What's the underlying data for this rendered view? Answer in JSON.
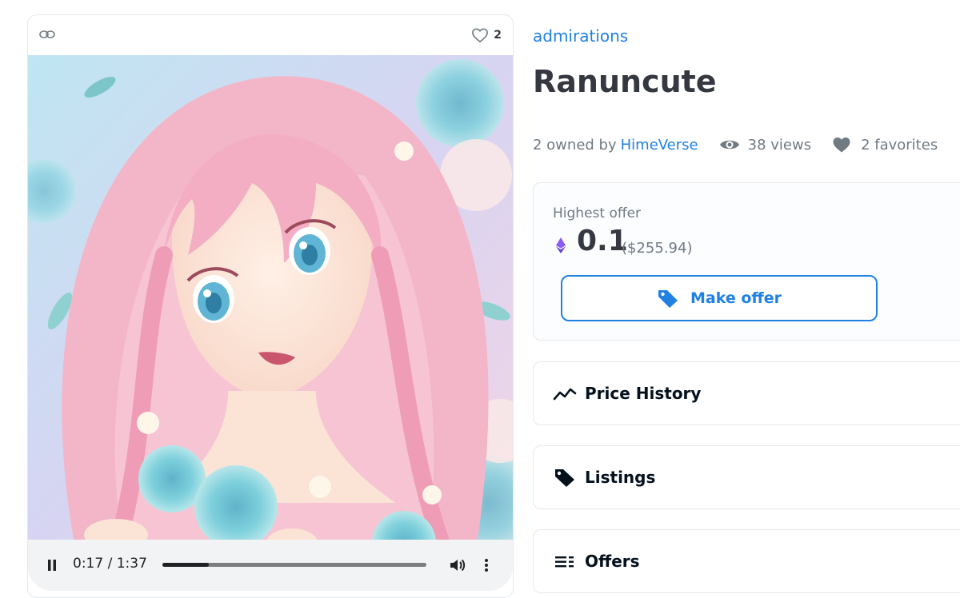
{
  "media": {
    "favorites_count": "2",
    "player": {
      "current_time": "0:17",
      "separator": "/",
      "duration": "1:37",
      "progress": 0.175
    }
  },
  "item": {
    "collection": "admirations",
    "title": "Ranuncute",
    "owned_prefix": "2 owned by",
    "owner": "HimeVerse",
    "views": "38 views",
    "favorites": "2 favorites"
  },
  "offer": {
    "label": "Highest offer",
    "price": "0.1",
    "usd": "($255.94)",
    "button_label": "Make offer"
  },
  "sections": [
    {
      "label": "Price History",
      "icon": "trend-line-icon"
    },
    {
      "label": "Listings",
      "icon": "tag-icon"
    },
    {
      "label": "Offers",
      "icon": "list-icon"
    }
  ],
  "colors": {
    "link": "#2081e2",
    "text": "#353840",
    "muted": "#707a83",
    "eth": "#8a5cf6"
  }
}
